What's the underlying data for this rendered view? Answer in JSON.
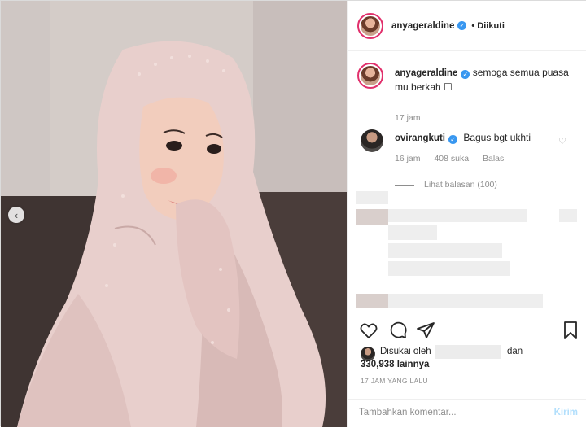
{
  "post": {
    "author": "anyageraldine",
    "follow_status": "Diikuti",
    "caption": "semoga semua puasa mu berkah ☐",
    "caption_time": "17 jam"
  },
  "comment": {
    "author": "ovirangkuti",
    "text": "Bagus bgt ukhti",
    "time": "16 jam",
    "likes": "408 suka",
    "reply_label": "Balas",
    "view_replies": "Lihat balasan (100)"
  },
  "likes": {
    "prefix": "Disukai oleh",
    "suffix": "dan",
    "count": "330,938 lainnya"
  },
  "timestamp": "17 JAM YANG LALU",
  "composer": {
    "placeholder": "Tambahkan komentar...",
    "send_label": "Kirim"
  },
  "icons": {
    "verified": "✓",
    "bullet": "•",
    "carousel_prev": "‹",
    "heart_small": "♡"
  },
  "colors": {
    "verified_blue": "#3897f0",
    "send_disabled": "#b2dffc",
    "story_ring": "#e1306c"
  }
}
